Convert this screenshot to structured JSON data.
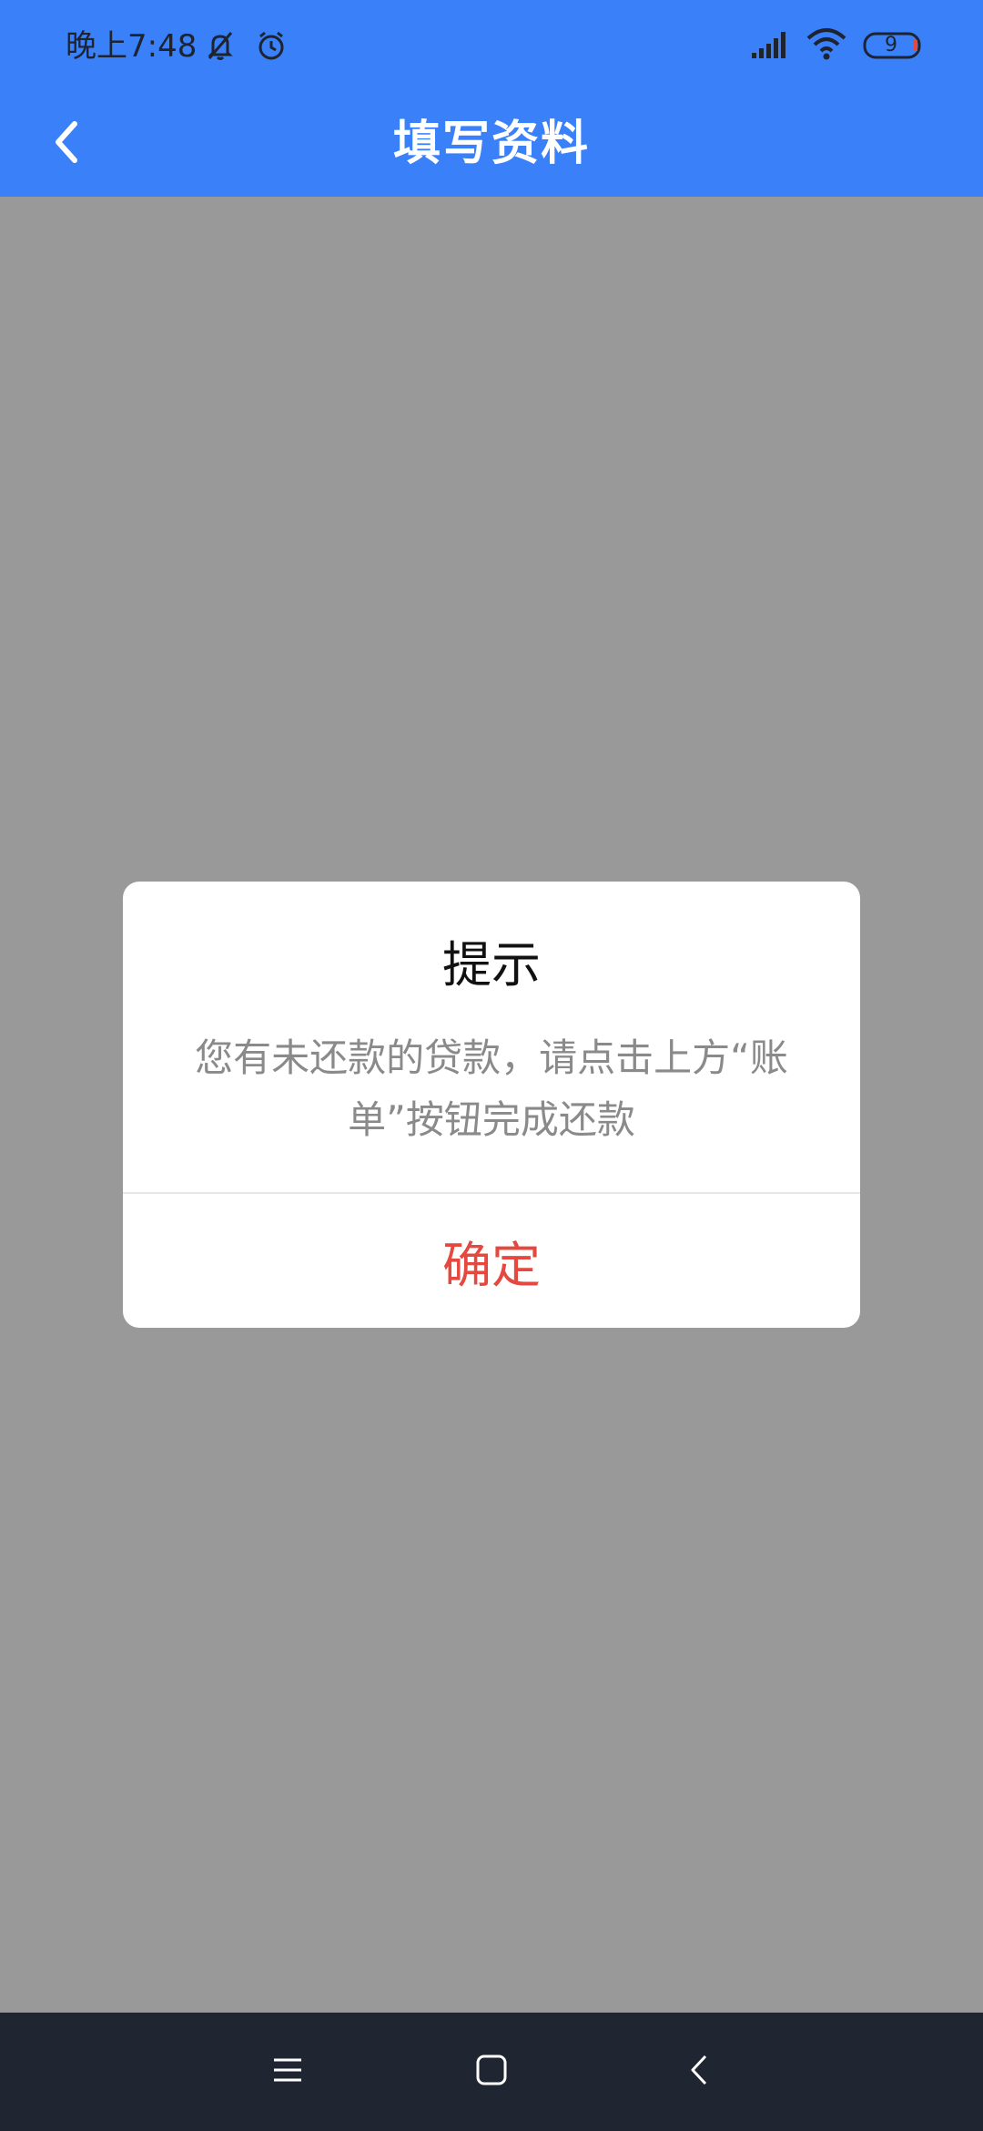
{
  "status_bar": {
    "time": "晚上7:48",
    "battery_level": "9",
    "icons": [
      "bell-off-icon",
      "alarm-clock-icon",
      "signal-icon",
      "wifi-icon",
      "battery-icon"
    ]
  },
  "app_bar": {
    "title": "填写资料",
    "back_icon": "chevron-left-icon",
    "background_color": "#3A80F8"
  },
  "dialog": {
    "title": "提示",
    "message": "您有未还款的贷款，请点击上方“账单”按钮完成还款",
    "confirm_label": "确定",
    "confirm_color": "#E5483F"
  },
  "nav_bar": {
    "buttons": [
      "menu-icon",
      "home-icon",
      "back-icon"
    ],
    "background_color": "#1F2531"
  },
  "overlay_color": "#999999"
}
